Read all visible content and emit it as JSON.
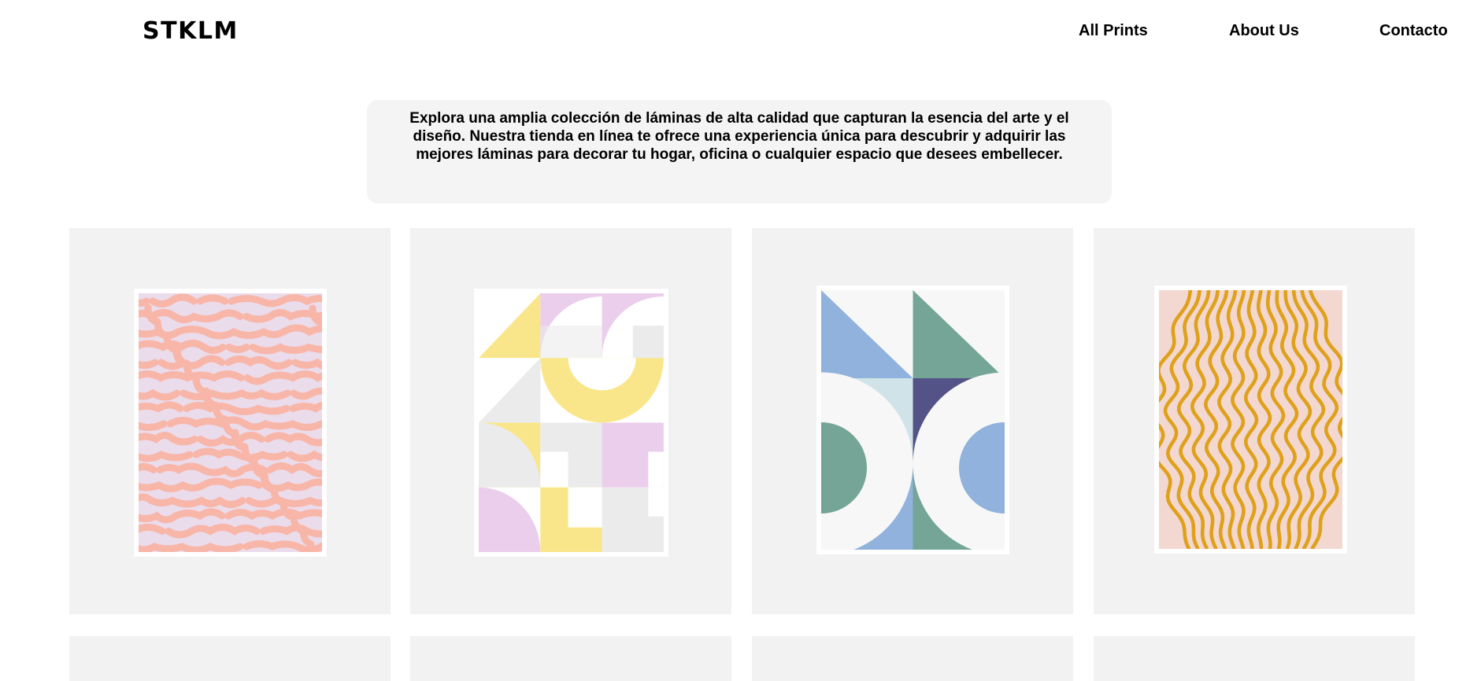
{
  "header": {
    "logo": "STKLM",
    "nav": [
      {
        "label": "All Prints"
      },
      {
        "label": "About Us"
      },
      {
        "label": "Contacto"
      }
    ]
  },
  "intro": {
    "text": "Explora una amplia colección de láminas de alta calidad que capturan la esencia del arte y el diseño. Nuestra tienda en línea te ofrece una experiencia única para descubrir y adquirir las mejores láminas para decorar tu hogar, oficina o cualquier espacio que desees embellecer."
  },
  "products": [
    {
      "art": "coral-maze",
      "colors": {
        "bg": "#ebdcec",
        "line": "#f8b6a8"
      }
    },
    {
      "art": "bauhaus-pastel",
      "colors": {
        "yellow": "#fae68a",
        "lilac": "#ebcdec",
        "gray": "#ebebeb",
        "white": "#ffffff"
      }
    },
    {
      "art": "geometric-blue-green",
      "colors": {
        "blue": "#91b2dd",
        "green": "#74a597",
        "navy": "#545387",
        "pale": "#d0e3e8",
        "bg": "#f7f7f7"
      }
    },
    {
      "art": "golden-waves",
      "colors": {
        "bg": "#f3d8d1",
        "line": "#dfa11a"
      }
    }
  ],
  "second_row_count": 4
}
